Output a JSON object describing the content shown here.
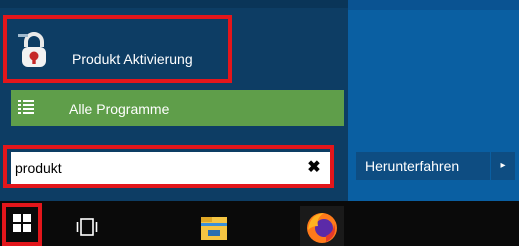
{
  "start_menu": {
    "program": {
      "label": "Produkt Aktivierung",
      "icon": "padlock-app-icon"
    },
    "all_programs": {
      "label": "Alle Programme",
      "icon": "list-icon"
    },
    "search": {
      "value": "produkt",
      "clear_icon": "close-icon"
    },
    "shutdown": {
      "label": "Herunterfahren",
      "arrow": "▸"
    }
  },
  "taskbar": {
    "items": [
      {
        "name": "start-button",
        "icon": "windows-logo-icon"
      },
      {
        "name": "task-view",
        "icon": "task-view-icon"
      },
      {
        "name": "file-explorer",
        "icon": "folder-icon"
      },
      {
        "name": "firefox",
        "icon": "firefox-icon"
      }
    ]
  },
  "colors": {
    "accent": "#5f9e4a",
    "highlight": "#e3161b",
    "left_pane": "#0d3d64",
    "right_pane": "#0a5fa2",
    "taskbar": "#0a0a0a"
  }
}
